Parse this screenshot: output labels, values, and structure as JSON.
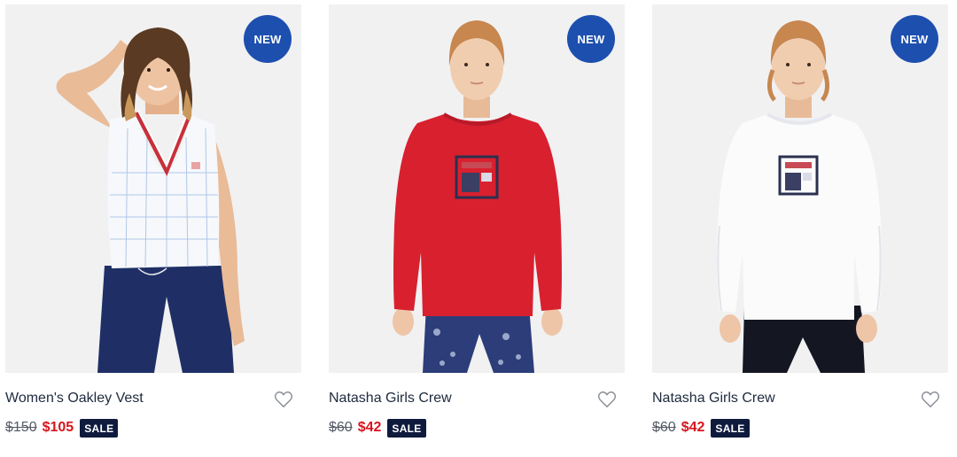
{
  "products": [
    {
      "badge": "NEW",
      "name": "Women's Oakley Vest",
      "old_price": "$150",
      "sale_price": "$105",
      "sale_label": "SALE",
      "image": "model-white-plaid-v-neck-vest-navy-pants"
    },
    {
      "badge": "NEW",
      "name": "Natasha Girls Crew",
      "old_price": "$60",
      "sale_price": "$42",
      "sale_label": "SALE",
      "image": "girl-red-fila-crew-sweatshirt-paisley-leggings"
    },
    {
      "badge": "NEW",
      "name": "Natasha Girls Crew",
      "old_price": "$60",
      "sale_price": "$42",
      "sale_label": "SALE",
      "image": "girl-white-fila-crew-sweatshirt-black-leggings"
    }
  ],
  "colors": {
    "new_badge": "#1d4fae",
    "sale_price": "#d8141e",
    "sale_badge": "#0e1b3d",
    "image_bg": "#f1f1f2"
  },
  "icons": {
    "wishlist": "heart-outline-icon"
  }
}
